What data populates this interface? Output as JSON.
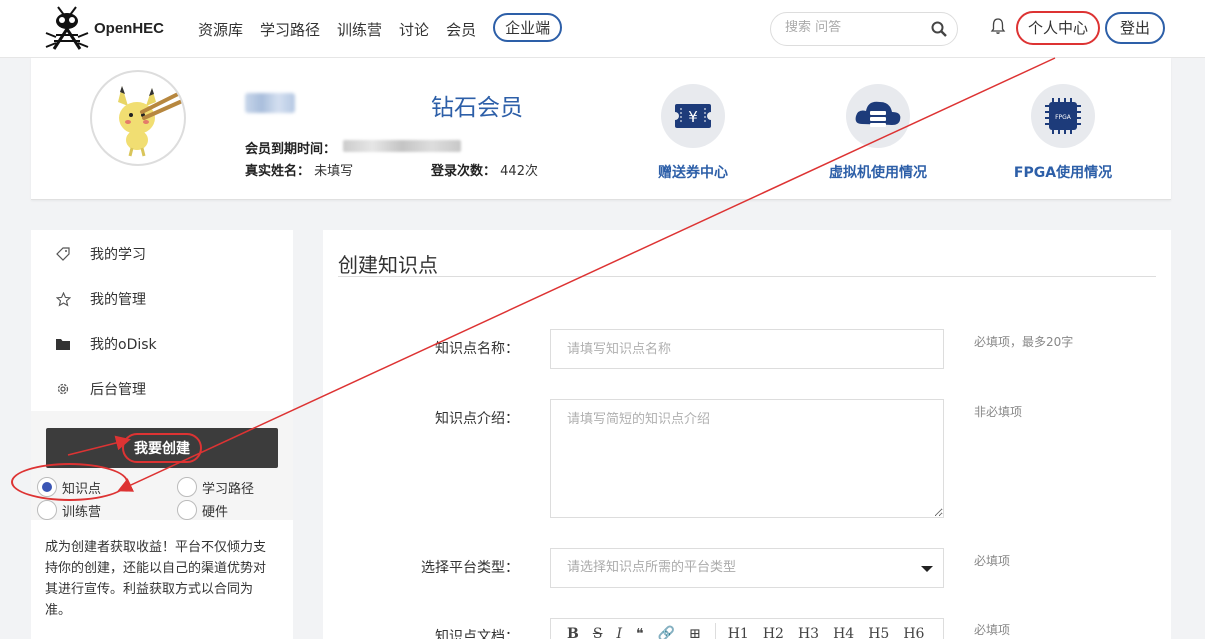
{
  "header": {
    "logo_text": "OpenHEC",
    "nav": [
      "资源库",
      "学习路径",
      "训练营",
      "讨论",
      "会员"
    ],
    "enterprise": "企业端",
    "search_placeholder": "搜索 问答",
    "user_center": "个人中心",
    "logout": "登出"
  },
  "profile": {
    "member_level": "钻石会员",
    "expire_label": "会员到期时间：",
    "realname_label": "真实姓名：",
    "realname_value": "未填写",
    "login_count_label": "登录次数：",
    "login_count_value": "442次",
    "stats": [
      "赠送券中心",
      "虚拟机使用情况",
      "FPGA使用情况"
    ]
  },
  "sidebar": {
    "items": [
      "我的学习",
      "我的管理",
      "我的oDisk",
      "后台管理"
    ],
    "create_button": "我要创建",
    "radio_options": [
      "知识点",
      "学习路径",
      "训练营",
      "硬件"
    ],
    "selected_radio": "知识点",
    "promo_text": "成为创建者获取收益！平台不仅倾力支持你的创建，还能以自己的渠道优势对其进行宣传。利益获取方式以合同为准。"
  },
  "form": {
    "title": "创建知识点",
    "fields": [
      {
        "label": "知识点名称：",
        "placeholder": "请填写知识点名称",
        "hint": "必填项，最多20字"
      },
      {
        "label": "知识点介绍：",
        "placeholder": "请填写简短的知识点介绍",
        "hint": "非必填项"
      },
      {
        "label": "选择平台类型：",
        "placeholder": "请选择知识点所需的平台类型",
        "hint": "必填项"
      },
      {
        "label": "知识点文档：",
        "hint": "必填项"
      }
    ],
    "editor_toolbar": [
      "B",
      "S",
      "I",
      "❝",
      "🔗",
      "⊞",
      "H1",
      "H2",
      "H3",
      "H4",
      "H5",
      "H6"
    ]
  },
  "colors": {
    "brand_blue": "#2d5fa8",
    "annotation_red": "#dd3333",
    "dark_button": "#3c3c3c"
  }
}
